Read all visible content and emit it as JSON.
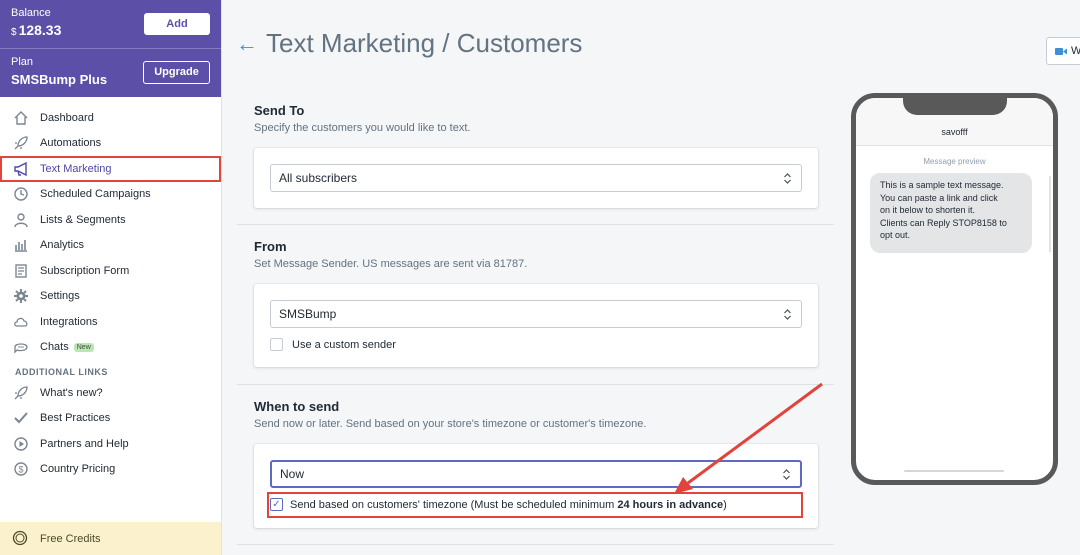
{
  "sidebar": {
    "balance_label": "Balance",
    "balance_currency": "$",
    "balance_value": "128.33",
    "add_label": "Add",
    "plan_label": "Plan",
    "plan_value": "SMSBump Plus",
    "upgrade_label": "Upgrade",
    "items": [
      {
        "label": "Dashboard",
        "icon": "home-icon"
      },
      {
        "label": "Automations",
        "icon": "rocket-icon"
      },
      {
        "label": "Text Marketing",
        "icon": "megaphone-icon"
      },
      {
        "label": "Scheduled Campaigns",
        "icon": "clock-icon"
      },
      {
        "label": "Lists & Segments",
        "icon": "person-icon"
      },
      {
        "label": "Analytics",
        "icon": "bar-chart-icon"
      },
      {
        "label": "Subscription Form",
        "icon": "form-icon"
      },
      {
        "label": "Settings",
        "icon": "gear-icon"
      },
      {
        "label": "Integrations",
        "icon": "cloud-icon"
      },
      {
        "label": "Chats",
        "icon": "chat-icon",
        "badge": "New"
      }
    ],
    "additional_heading": "ADDITIONAL LINKS",
    "additional_items": [
      {
        "label": "What's new?",
        "icon": "rocket-icon"
      },
      {
        "label": "Best Practices",
        "icon": "check-icon"
      },
      {
        "label": "Partners and Help",
        "icon": "play-icon"
      },
      {
        "label": "Country Pricing",
        "icon": "dollar-icon"
      }
    ],
    "free_credits_label": "Free Credits"
  },
  "header": {
    "back_icon": "←",
    "title": "Text Marketing / Customers",
    "video_label": "W"
  },
  "send_to": {
    "title": "Send To",
    "subtitle": "Specify the customers you would like to text.",
    "selected": "All subscribers"
  },
  "from": {
    "title": "From",
    "subtitle": "Set Message Sender. US messages are sent via 81787.",
    "selected": "SMSBump",
    "custom_sender_label": "Use a custom sender"
  },
  "when": {
    "title": "When to send",
    "subtitle": "Send now or later. Send based on your store's timezone or customer's timezone.",
    "selected": "Now",
    "timezone_label_prefix": "Send based on customers' timezone (Must be scheduled minimum ",
    "timezone_label_bold": "24 hours in advance",
    "timezone_label_suffix": ")",
    "timezone_checked": true
  },
  "preview": {
    "sender": "savofff",
    "label": "Message preview",
    "message_lines": [
      "This is a sample text message.",
      "You can paste a link and click",
      "on it below to shorten it.",
      "Clients can Reply STOP8158 to",
      "opt out."
    ]
  },
  "colors": {
    "brand": "#5c4fa8",
    "annotation": "#e0443a",
    "link": "#3d8fd8"
  }
}
